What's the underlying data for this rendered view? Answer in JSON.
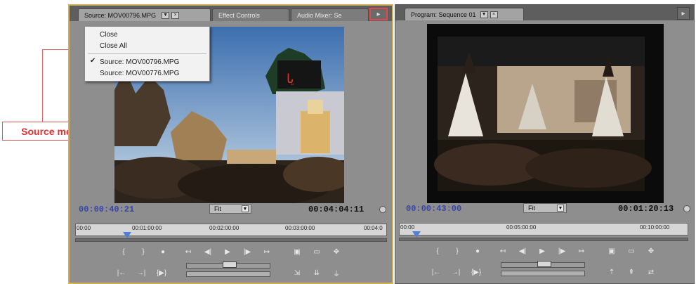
{
  "callout": {
    "label": "Source menu",
    "color": "#e0302f"
  },
  "source_panel": {
    "tabs": [
      {
        "label": "Source: MOV00796.MPG"
      },
      {
        "label": "Effect Controls"
      },
      {
        "label": "Audio Mixer: Se"
      }
    ],
    "menu_button_icon": "panel-menu-arrow-icon",
    "menu": {
      "items": [
        {
          "label": "Close",
          "checked": false
        },
        {
          "label": "Close All",
          "checked": false
        },
        {
          "separator": true
        },
        {
          "label": "Source: MOV00796.MPG",
          "checked": true
        },
        {
          "label": "Source: MOV00776.MPG",
          "checked": false
        }
      ]
    },
    "current_timecode": "00:00:40:21",
    "zoom": "Fit",
    "duration": "00:04:04:11",
    "ruler_labels": [
      "00:00",
      "00:01:00:00",
      "00:02:00:00",
      "00:03:00:00",
      "00:04:0"
    ],
    "playhead_fraction": 0.167
  },
  "program_panel": {
    "tabs": [
      {
        "label": "Program: Sequence 01"
      }
    ],
    "current_timecode": "00:00:43:00",
    "zoom": "Fit",
    "duration": "00:01:20:13",
    "ruler_labels": [
      "00:00",
      "00:05:00:00",
      "00:10:00:00"
    ],
    "playhead_fraction": 0.06
  },
  "colors": {
    "selection_border": "#d4b15a",
    "timecode_current": "#3846a8",
    "highlight": "#e04a4a"
  }
}
